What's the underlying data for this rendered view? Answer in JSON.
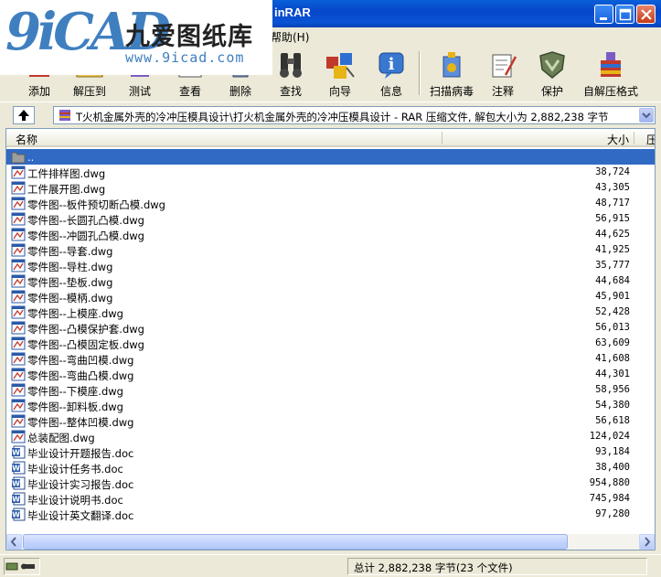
{
  "window": {
    "title": "inRAR"
  },
  "watermark": {
    "logo_big": "9iCAD",
    "logo_cn": "九爱图纸库",
    "logo_url": "www.9icad.com"
  },
  "menu": {
    "help": "帮助(H)"
  },
  "toolbar": {
    "items": [
      {
        "label": "添加",
        "icon": "add-archive-icon"
      },
      {
        "label": "解压到",
        "icon": "extract-to-icon"
      },
      {
        "label": "测试",
        "icon": "test-icon"
      },
      {
        "label": "查看",
        "icon": "view-icon"
      },
      {
        "label": "删除",
        "icon": "delete-icon"
      },
      {
        "label": "查找",
        "icon": "find-binoculars-icon"
      },
      {
        "label": "向导",
        "icon": "wizard-icon"
      },
      {
        "label": "信息",
        "icon": "info-icon"
      },
      {
        "label": "扫描病毒",
        "icon": "virus-scan-icon"
      },
      {
        "label": "注释",
        "icon": "comment-icon"
      },
      {
        "label": "保护",
        "icon": "protect-shield-icon"
      },
      {
        "label": "自解压格式",
        "icon": "sfx-icon"
      }
    ]
  },
  "address": {
    "path": "T火机金属外壳的冷冲压模具设计\\打火机金属外壳的冷冲压模具设计 - RAR 压缩文件, 解包大小为 2,882,238 字节"
  },
  "list": {
    "columns": {
      "name": "名称",
      "size": "大小",
      "packed": "压"
    },
    "parent": "..",
    "files": [
      {
        "name": "工件排样图.dwg",
        "size": "38,724",
        "type": "dwg"
      },
      {
        "name": "工件展开图.dwg",
        "size": "43,305",
        "type": "dwg"
      },
      {
        "name": "零件图--板件预切断凸模.dwg",
        "size": "48,717",
        "type": "dwg"
      },
      {
        "name": "零件图--长圆孔凸模.dwg",
        "size": "56,915",
        "type": "dwg"
      },
      {
        "name": "零件图--冲圆孔凸模.dwg",
        "size": "44,625",
        "type": "dwg"
      },
      {
        "name": "零件图--导套.dwg",
        "size": "41,925",
        "type": "dwg"
      },
      {
        "name": "零件图--导柱.dwg",
        "size": "35,777",
        "type": "dwg"
      },
      {
        "name": "零件图--垫板.dwg",
        "size": "44,684",
        "type": "dwg"
      },
      {
        "name": "零件图--模柄.dwg",
        "size": "45,901",
        "type": "dwg"
      },
      {
        "name": "零件图--上模座.dwg",
        "size": "52,428",
        "type": "dwg"
      },
      {
        "name": "零件图--凸模保护套.dwg",
        "size": "56,013",
        "type": "dwg"
      },
      {
        "name": "零件图--凸模固定板.dwg",
        "size": "63,609",
        "type": "dwg"
      },
      {
        "name": "零件图--弯曲凹模.dwg",
        "size": "41,608",
        "type": "dwg"
      },
      {
        "name": "零件图--弯曲凸模.dwg",
        "size": "44,301",
        "type": "dwg"
      },
      {
        "name": "零件图--下模座.dwg",
        "size": "58,956",
        "type": "dwg"
      },
      {
        "name": "零件图--卸料板.dwg",
        "size": "54,380",
        "type": "dwg"
      },
      {
        "name": "零件图--整体凹模.dwg",
        "size": "56,618",
        "type": "dwg"
      },
      {
        "name": "总装配图.dwg",
        "size": "124,024",
        "type": "dwg"
      },
      {
        "name": "毕业设计开题报告.doc",
        "size": "93,184",
        "type": "doc"
      },
      {
        "name": "毕业设计任务书.doc",
        "size": "38,400",
        "type": "doc"
      },
      {
        "name": "毕业设计实习报告.doc",
        "size": "954,880",
        "type": "doc"
      },
      {
        "name": "毕业设计说明书.doc",
        "size": "745,984",
        "type": "doc"
      },
      {
        "name": "毕业设计英文翻译.doc",
        "size": "97,280",
        "type": "doc"
      }
    ]
  },
  "status": {
    "total": "总计 2,882,238 字节(23 个文件)"
  },
  "colors": {
    "selection": "#316AC5",
    "titlebar": "#0A54D4"
  }
}
